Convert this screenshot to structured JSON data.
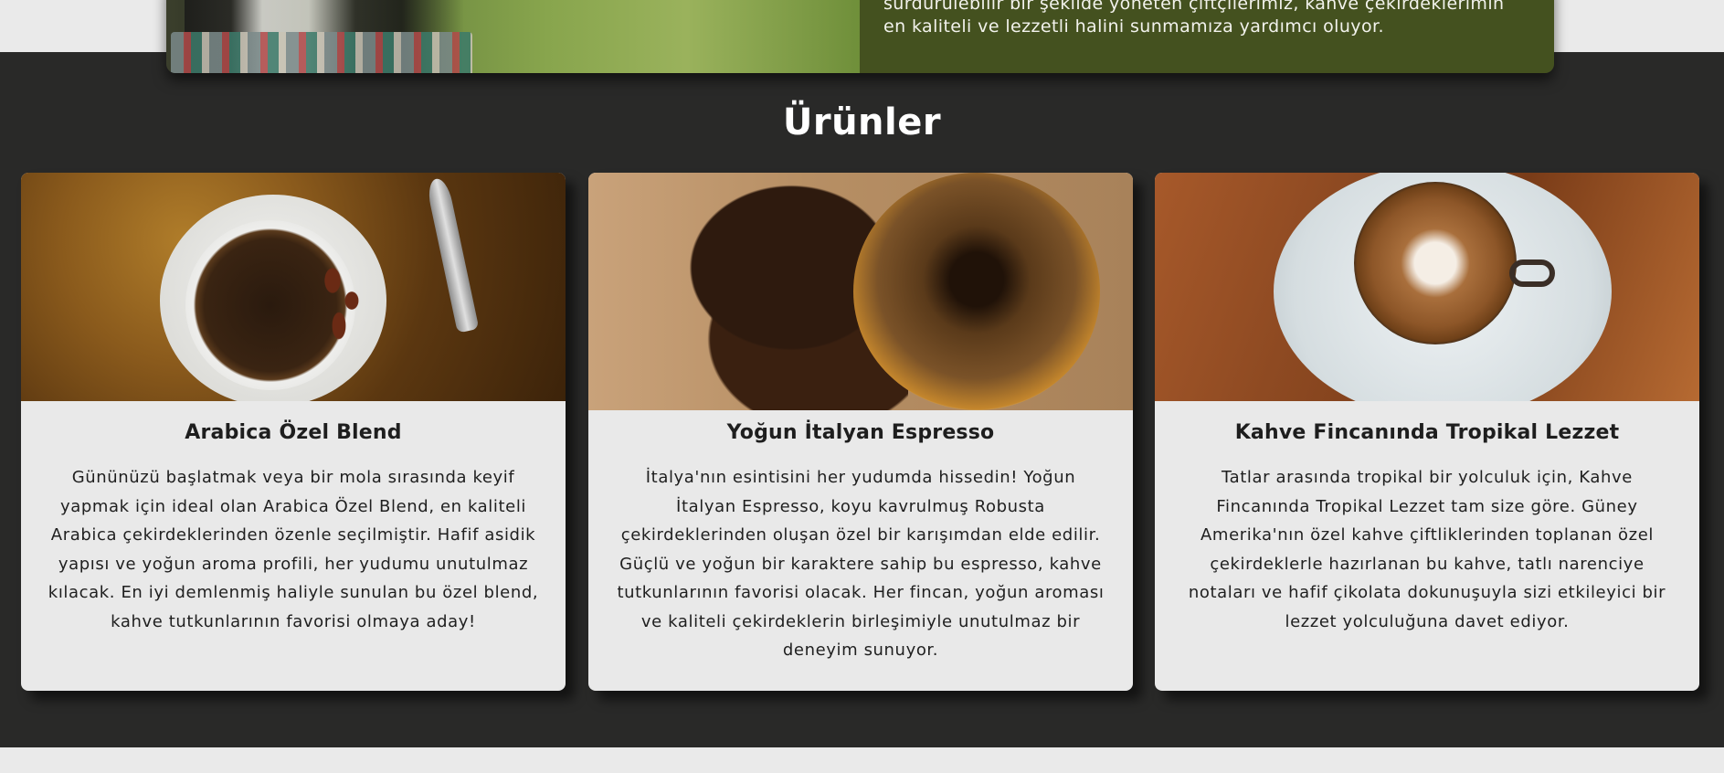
{
  "about": {
    "text_line_1": "sürdürülebilir bir şekilde yöneten çiftçilerimiz, kahve çekirdeklerimin",
    "text_line_2": "en kaliteli ve lezzetli halini sunmamıza yardımcı oluyor."
  },
  "products": {
    "title": "Ürünler",
    "items": [
      {
        "title": "Arabica Özel Blend",
        "description": "Gününüzü başlatmak veya bir mola sırasında keyif yapmak için ideal olan Arabica Özel Blend, en kaliteli Arabica çekirdeklerinden özenle seçilmiştir. Hafif asidik yapısı ve yoğun aroma profili, her yudumu unutulmaz kılacak. En iyi demlenmiş haliyle sunulan bu özel blend, kahve tutkunlarının favorisi olmaya aday!"
      },
      {
        "title": "Yoğun İtalyan Espresso",
        "description": "İtalya'nın esintisini her yudumda hissedin! Yoğun İtalyan Espresso, koyu kavrulmuş Robusta çekirdeklerinden oluşan özel bir karışımdan elde edilir. Güçlü ve yoğun bir karaktere sahip bu espresso, kahve tutkunlarının favorisi olacak. Her fincan, yoğun aroması ve kaliteli çekirdeklerin birleşimiyle unutulmaz bir deneyim sunuyor."
      },
      {
        "title": "Kahve Fincanında Tropikal Lezzet",
        "description": "Tatlar arasında tropikal bir yolculuk için, Kahve Fincanında Tropikal Lezzet tam size göre. Güney Amerika'nın özel kahve çiftliklerinden toplanan özel çekirdeklerle hazırlanan bu kahve, tatlı narenciye notaları ve hafif çikolata dokunuşuyla sizi etkileyici bir lezzet yolculuğuna davet ediyor."
      }
    ]
  },
  "colors": {
    "dark_band": "#292928",
    "about_panel": "#44511f",
    "card_bg": "#e9e9e9"
  }
}
